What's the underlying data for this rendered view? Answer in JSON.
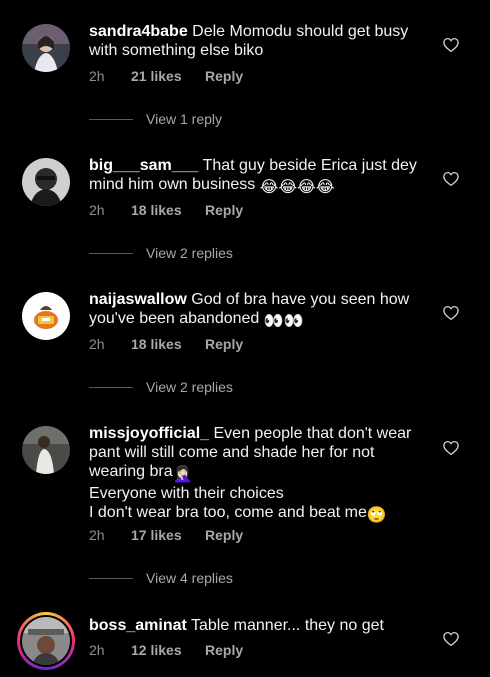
{
  "comments": [
    {
      "username": "sandra4babe",
      "text": "Dele Momodu should get busy with something else biko",
      "time": "2h",
      "likes": "21 likes",
      "reply_label": "Reply",
      "view_replies": "View 1 reply"
    },
    {
      "username": "big___sam___",
      "text": "That guy beside Erica just dey mind him own business",
      "emoji": "😂😂😂😂",
      "time": "2h",
      "likes": "18 likes",
      "reply_label": "Reply",
      "view_replies": "View 2 replies"
    },
    {
      "username": "naijaswallow",
      "text": "God of bra have you seen how you've been abandoned",
      "emoji": "👀👀",
      "time": "2h",
      "likes": "18 likes",
      "reply_label": "Reply",
      "view_replies": "View 2 replies"
    },
    {
      "username": "missjoyofficial_",
      "text": "Even people that don't wear pant will still come and shade her for not wearing bra",
      "emoji": "🤦🏻‍♀️",
      "line2": "Everyone with their choices",
      "line3": "I don't wear bra too, come and beat me",
      "emoji2": "🙄",
      "time": "2h",
      "likes": "17 likes",
      "reply_label": "Reply",
      "view_replies": "View 4 replies"
    },
    {
      "username": "boss_aminat",
      "text": "Table manner... they no get",
      "time": "2h",
      "likes": "12 likes",
      "reply_label": "Reply"
    }
  ],
  "icons": {
    "like": "heart-outline-icon"
  },
  "colors": {
    "background": "#000000",
    "text": "#f2f2f2",
    "meta": "#8e8e8e"
  }
}
